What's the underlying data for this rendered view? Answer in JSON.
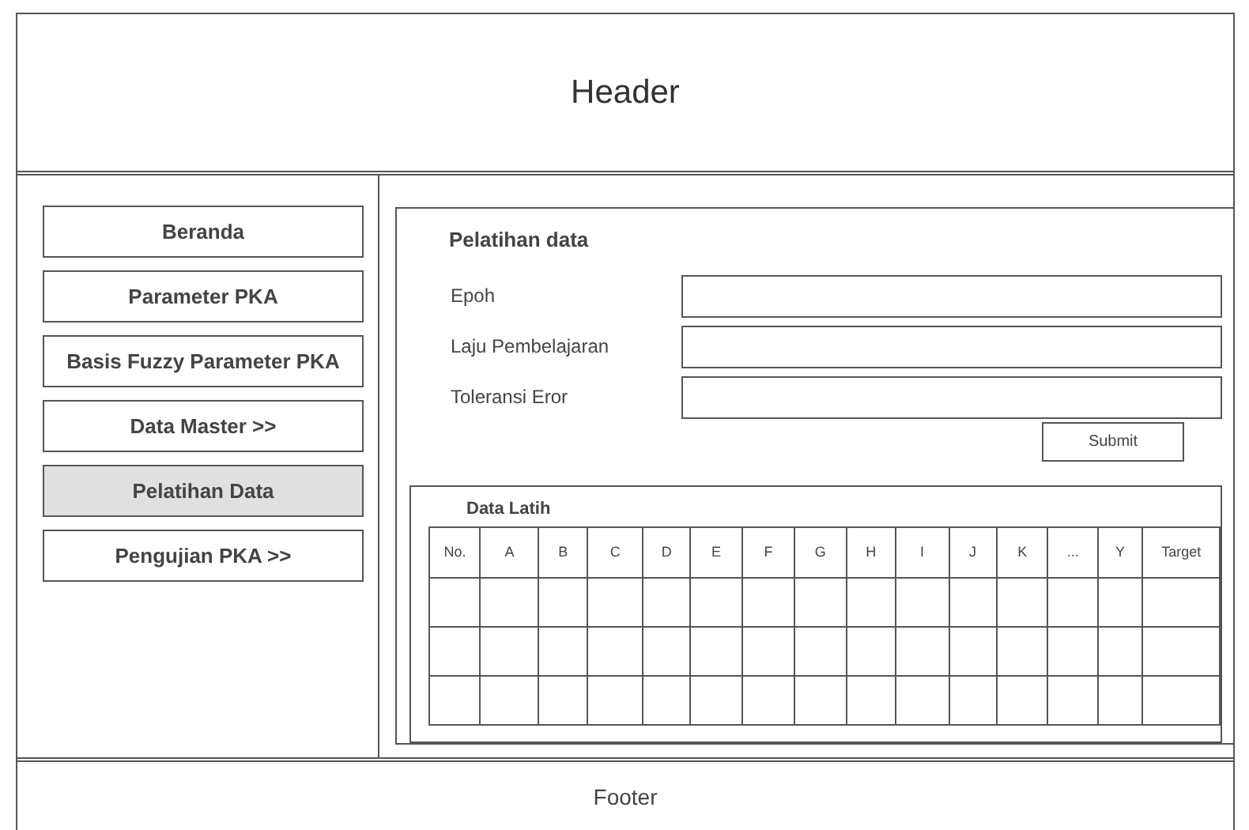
{
  "header": {
    "title": "Header"
  },
  "sidebar": {
    "items": [
      {
        "label": "Beranda",
        "selected": false
      },
      {
        "label": "Parameter PKA",
        "selected": false
      },
      {
        "label": "Basis Fuzzy Parameter PKA",
        "selected": false
      },
      {
        "label": "Data Master >>",
        "selected": false
      },
      {
        "label": "Pelatihan Data",
        "selected": true
      },
      {
        "label": "Pengujian PKA >>",
        "selected": false
      }
    ]
  },
  "form": {
    "title": "Pelatihan data",
    "fields": [
      {
        "label": "Epoh"
      },
      {
        "label": "Laju Pembelajaran"
      },
      {
        "label": "Toleransi Eror"
      }
    ],
    "submit": "Submit"
  },
  "table": {
    "title": "Data Latih",
    "columns": [
      "No.",
      "A",
      "B",
      "C",
      "D",
      "E",
      "F",
      "G",
      "H",
      "I",
      "J",
      "K",
      "...",
      "Y",
      "Target"
    ]
  },
  "footer": {
    "text": "Footer"
  }
}
